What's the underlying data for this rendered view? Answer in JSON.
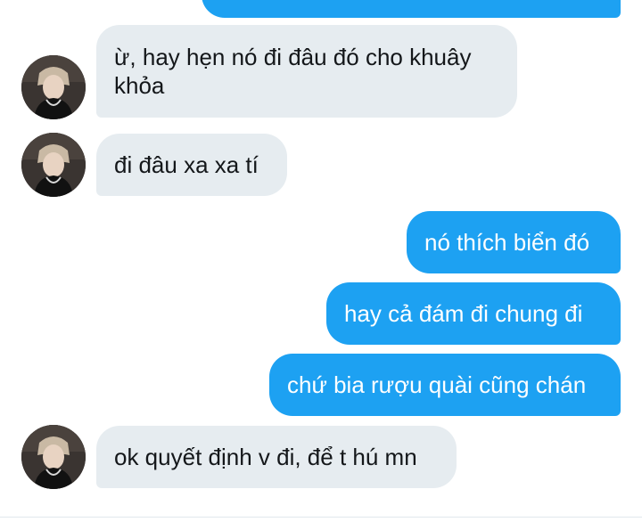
{
  "conversation": {
    "messages": [
      {
        "direction": "outgoing",
        "text": ""
      },
      {
        "direction": "incoming",
        "text": "ừ, hay hẹn nó đi đâu đó cho khuây khỏa"
      },
      {
        "direction": "incoming",
        "text": "đi đâu xa xa tí"
      },
      {
        "direction": "outgoing",
        "text": "nó thích biển đó"
      },
      {
        "direction": "outgoing",
        "text": "hay cả đám đi chung đi"
      },
      {
        "direction": "outgoing",
        "text": "chứ bia rượu quài cũng chán"
      },
      {
        "direction": "incoming",
        "text": "ok quyết định v đi, để t hú mn"
      }
    ]
  },
  "theme": {
    "incoming_bubble_color": "#e6ecf0",
    "outgoing_bubble_color": "#1da1f2",
    "incoming_text_color": "#14171a",
    "outgoing_text_color": "#ffffff"
  }
}
